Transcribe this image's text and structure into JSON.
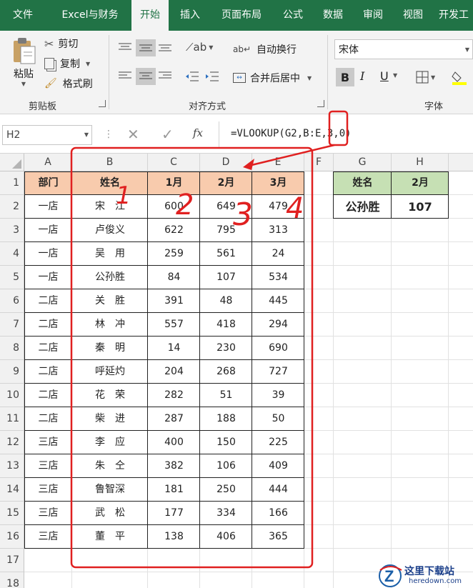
{
  "tabs": [
    "文件",
    "Excel与财务",
    "开始",
    "插入",
    "页面布局",
    "公式",
    "数据",
    "审阅",
    "视图",
    "开发工"
  ],
  "active_tab": 2,
  "ribbon": {
    "clipboard": {
      "paste": "粘贴",
      "cut": "剪切",
      "copy": "复制",
      "format_painter": "格式刷",
      "label": "剪贴板"
    },
    "alignment": {
      "wrap": "自动换行",
      "merge": "合并后居中",
      "label": "对齐方式"
    },
    "font": {
      "name": "宋体",
      "bold": "B",
      "italic": "I",
      "underline": "U",
      "label": "字体"
    }
  },
  "formula_bar": {
    "name_box": "H2",
    "formula": "=VLOOKUP(G2,B:E,3,0)",
    "fx": "fx"
  },
  "columns": [
    "A",
    "B",
    "C",
    "D",
    "E",
    "F",
    "G",
    "H"
  ],
  "rows": [
    "1",
    "2",
    "3",
    "4",
    "5",
    "6",
    "7",
    "8",
    "9",
    "10",
    "11",
    "12",
    "13",
    "14",
    "15",
    "16",
    "17",
    "18"
  ],
  "table": {
    "headers": [
      "部门",
      "姓名",
      "1月",
      "2月",
      "3月"
    ],
    "rows": [
      [
        "一店",
        "宋　江",
        "600",
        "649",
        "479"
      ],
      [
        "一店",
        "卢俊义",
        "622",
        "795",
        "313"
      ],
      [
        "一店",
        "吴　用",
        "259",
        "561",
        "24"
      ],
      [
        "一店",
        "公孙胜",
        "84",
        "107",
        "534"
      ],
      [
        "二店",
        "关　胜",
        "391",
        "48",
        "445"
      ],
      [
        "二店",
        "林　冲",
        "557",
        "418",
        "294"
      ],
      [
        "二店",
        "秦　明",
        "14",
        "230",
        "690"
      ],
      [
        "二店",
        "呼延灼",
        "204",
        "268",
        "727"
      ],
      [
        "二店",
        "花　荣",
        "282",
        "51",
        "39"
      ],
      [
        "二店",
        "柴　进",
        "287",
        "188",
        "50"
      ],
      [
        "三店",
        "李　应",
        "400",
        "150",
        "225"
      ],
      [
        "三店",
        "朱　仝",
        "382",
        "106",
        "409"
      ],
      [
        "三店",
        "鲁智深",
        "181",
        "250",
        "444"
      ],
      [
        "三店",
        "武　松",
        "177",
        "334",
        "166"
      ],
      [
        "三店",
        "董　平",
        "138",
        "406",
        "365"
      ]
    ]
  },
  "lookup": {
    "headers": [
      "姓名",
      "2月"
    ],
    "name": "公孙胜",
    "value": "107"
  },
  "annotations": {
    "numbers": [
      "1",
      "2",
      "3",
      "4"
    ]
  },
  "watermark": {
    "cn": "这里下载站",
    "en": "heredown.com"
  },
  "colors": {
    "accent": "#217346",
    "header_fill": "#f8cbad",
    "lookup_fill": "#c6e0b4",
    "annotation": "#e02020"
  }
}
